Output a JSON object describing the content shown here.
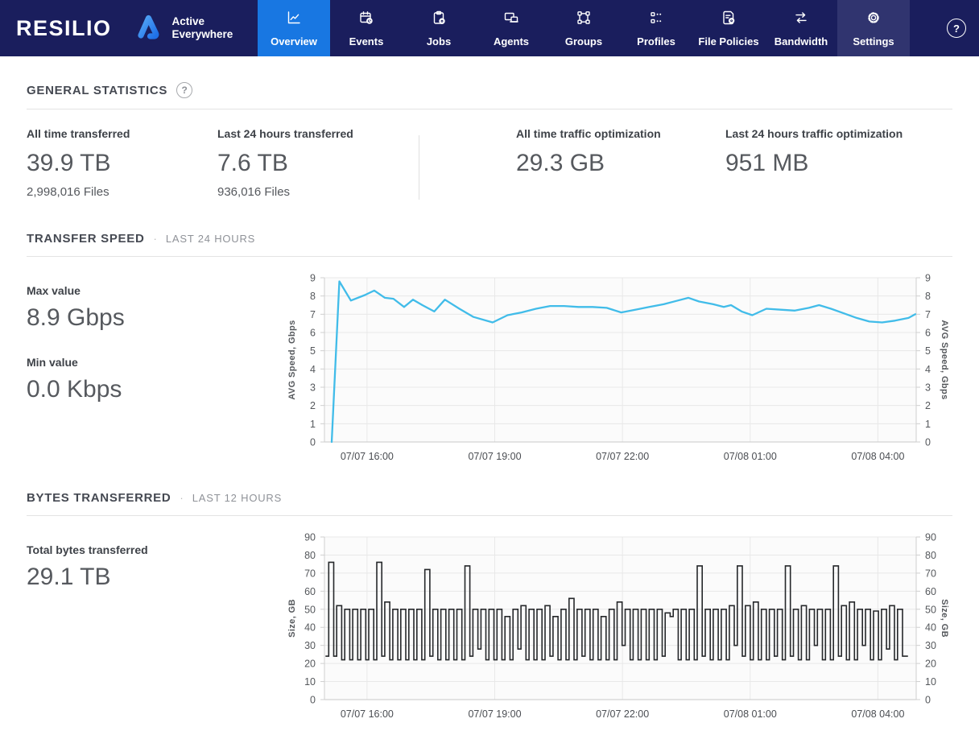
{
  "nav": {
    "brand": "RESILIO",
    "logo_line1": "Active",
    "logo_line2": "Everywhere",
    "items": [
      {
        "label": "Overview",
        "icon": "chart-line-icon",
        "active": true
      },
      {
        "label": "Events",
        "icon": "calendar-clock-icon"
      },
      {
        "label": "Jobs",
        "icon": "clipboard-gear-icon"
      },
      {
        "label": "Agents",
        "icon": "devices-icon"
      },
      {
        "label": "Groups",
        "icon": "nodes-icon"
      },
      {
        "label": "Profiles",
        "icon": "list-dots-icon"
      },
      {
        "label": "File Policies",
        "icon": "file-gear-icon"
      },
      {
        "label": "Bandwidth",
        "icon": "transfer-arrows-icon"
      },
      {
        "label": "Settings",
        "icon": "gear-icon",
        "highlighted": true
      }
    ],
    "help_label": "?"
  },
  "general_stats": {
    "title": "GENERAL STATISTICS",
    "help_glyph": "?",
    "stats": [
      {
        "label": "All time transferred",
        "value": "39.9 TB",
        "sub": "2,998,016 Files"
      },
      {
        "label": "Last 24 hours transferred",
        "value": "7.6 TB",
        "sub": "936,016 Files"
      },
      {
        "label": "All time traffic optimization",
        "value": "29.3 GB",
        "sub": ""
      },
      {
        "label": "Last 24 hours traffic optimization",
        "value": "951 MB",
        "sub": ""
      }
    ]
  },
  "transfer_speed": {
    "title": "TRANSFER SPEED",
    "separator": "·",
    "period": "LAST 24 HOURS",
    "max_label": "Max value",
    "max_value": "8.9 Gbps",
    "min_label": "Min value",
    "min_value": "0.0 Kbps"
  },
  "bytes_transferred": {
    "title": "BYTES TRANSFERRED",
    "separator": "·",
    "period": "LAST 12 HOURS",
    "total_label": "Total bytes transferred",
    "total_value": "29.1 TB"
  },
  "colors": {
    "nav_bg": "#1a1e5d",
    "nav_active": "#1877e2",
    "nav_highlight": "#30346f",
    "line_series": "#41bce9",
    "bar_stroke": "#26282b",
    "grid": "#e8e8e8",
    "axis": "#cfcfcf",
    "plot_bg": "#fbfbfb",
    "logo_blue_light": "#55a7f5",
    "logo_blue_dark": "#1e6fe8"
  },
  "chart_data": [
    {
      "type": "line",
      "title": "Transfer speed",
      "ylabel": "AVG Speed, Gbps",
      "series_color": "#41bce9",
      "ylim": [
        0,
        9
      ],
      "ytick_step": 1,
      "xlim": [
        15.0,
        28.9
      ],
      "x_ticks": [
        {
          "t": 16,
          "label": "07/07 16:00"
        },
        {
          "t": 19,
          "label": "07/07 19:00"
        },
        {
          "t": 22,
          "label": "07/07 22:00"
        },
        {
          "t": 25,
          "label": "07/08 01:00"
        },
        {
          "t": 28,
          "label": "07/08 04:00"
        }
      ],
      "points": [
        [
          15.17,
          0
        ],
        [
          15.35,
          8.8
        ],
        [
          15.62,
          7.75
        ],
        [
          15.95,
          8.05
        ],
        [
          16.17,
          8.3
        ],
        [
          16.42,
          7.9
        ],
        [
          16.62,
          7.85
        ],
        [
          16.87,
          7.4
        ],
        [
          17.08,
          7.8
        ],
        [
          17.3,
          7.5
        ],
        [
          17.58,
          7.15
        ],
        [
          17.83,
          7.8
        ],
        [
          18.17,
          7.3
        ],
        [
          18.5,
          6.85
        ],
        [
          18.95,
          6.55
        ],
        [
          19.3,
          6.95
        ],
        [
          19.63,
          7.1
        ],
        [
          19.97,
          7.3
        ],
        [
          20.3,
          7.45
        ],
        [
          20.63,
          7.45
        ],
        [
          20.97,
          7.4
        ],
        [
          21.3,
          7.4
        ],
        [
          21.63,
          7.35
        ],
        [
          21.97,
          7.1
        ],
        [
          22.3,
          7.25
        ],
        [
          22.63,
          7.4
        ],
        [
          22.97,
          7.55
        ],
        [
          23.3,
          7.75
        ],
        [
          23.55,
          7.9
        ],
        [
          23.8,
          7.7
        ],
        [
          24.13,
          7.55
        ],
        [
          24.38,
          7.4
        ],
        [
          24.55,
          7.5
        ],
        [
          24.8,
          7.15
        ],
        [
          25.05,
          6.95
        ],
        [
          25.38,
          7.3
        ],
        [
          25.72,
          7.25
        ],
        [
          26.05,
          7.2
        ],
        [
          26.38,
          7.35
        ],
        [
          26.62,
          7.5
        ],
        [
          26.9,
          7.3
        ],
        [
          27.2,
          7.05
        ],
        [
          27.5,
          6.8
        ],
        [
          27.8,
          6.6
        ],
        [
          28.1,
          6.55
        ],
        [
          28.4,
          6.65
        ],
        [
          28.72,
          6.8
        ],
        [
          28.88,
          7.0
        ]
      ]
    },
    {
      "type": "step-outline",
      "title": "Bytes transferred",
      "ylabel": "Size, GB",
      "series_color": "#26282b",
      "ylim": [
        0,
        90
      ],
      "ytick_step": 10,
      "xlim": [
        15.0,
        28.9
      ],
      "x_ticks": [
        {
          "t": 16,
          "label": "07/07 16:00"
        },
        {
          "t": 19,
          "label": "07/07 19:00"
        },
        {
          "t": 22,
          "label": "07/07 22:00"
        },
        {
          "t": 25,
          "label": "07/08 01:00"
        },
        {
          "t": 28,
          "label": "07/08 04:00"
        }
      ],
      "bars_t_start": 15.1,
      "bars_t_end": 28.65,
      "bar_peaks": [
        76,
        52,
        50,
        50,
        50,
        50,
        76,
        54,
        50,
        50,
        50,
        50,
        72,
        50,
        50,
        50,
        50,
        74,
        50,
        50,
        50,
        50,
        46,
        50,
        52,
        50,
        50,
        52,
        46,
        50,
        56,
        50,
        50,
        50,
        46,
        50,
        54,
        50,
        50,
        50,
        50,
        50,
        48,
        50,
        50,
        50,
        74,
        50,
        50,
        50,
        52,
        74,
        52,
        54,
        50,
        50,
        50,
        74,
        50,
        52,
        50,
        50,
        50,
        74,
        52,
        54,
        50,
        50,
        49,
        50,
        52,
        50
      ],
      "bar_valleys": [
        24,
        22,
        22,
        22,
        22,
        22,
        24,
        22,
        22,
        22,
        22,
        22,
        24,
        22,
        22,
        22,
        22,
        24,
        28,
        22,
        22,
        22,
        22,
        28,
        22,
        22,
        22,
        24,
        22,
        22,
        22,
        24,
        22,
        22,
        22,
        22,
        30,
        22,
        22,
        22,
        22,
        24,
        46,
        22,
        22,
        22,
        24,
        22,
        22,
        22,
        30,
        24,
        22,
        22,
        22,
        24,
        22,
        24,
        22,
        22,
        30,
        22,
        22,
        24,
        22,
        22,
        30,
        22,
        22,
        28,
        22,
        24
      ]
    }
  ]
}
